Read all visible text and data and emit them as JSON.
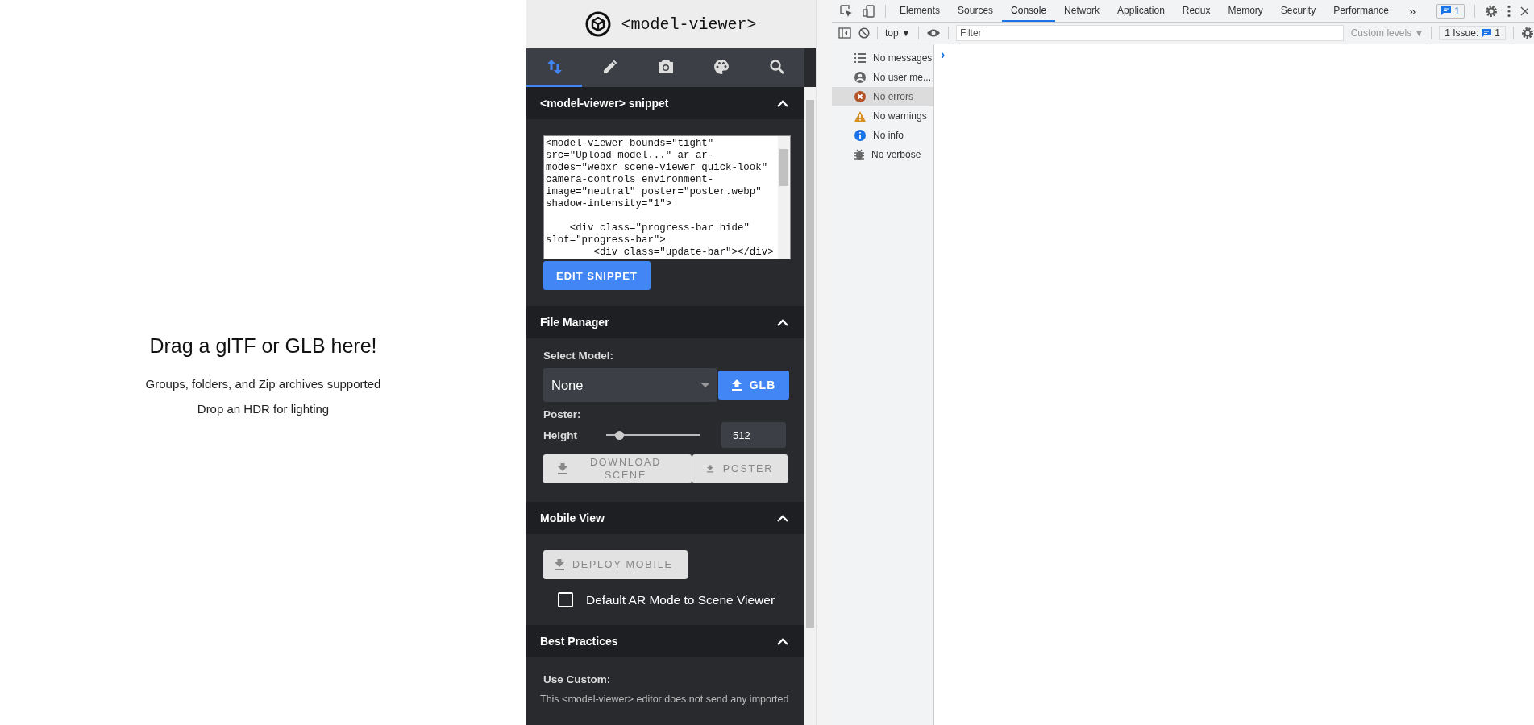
{
  "drop_zone": {
    "title": "Drag a glTF or GLB here!",
    "lines": [
      "Groups, folders, and Zip archives supported",
      "Drop an HDR for lighting"
    ]
  },
  "editor": {
    "logo_text": "<model-viewer>",
    "tabs": [
      {
        "kind": "import",
        "selected": true
      },
      {
        "kind": "edit",
        "selected": false
      },
      {
        "kind": "camera",
        "selected": false
      },
      {
        "kind": "palette",
        "selected": false
      },
      {
        "kind": "search",
        "selected": false
      }
    ],
    "snippet": {
      "header": "<model-viewer> snippet",
      "expanded": true,
      "code": "<model-viewer bounds=\"tight\"\nsrc=\"Upload model...\" ar ar-\nmodes=\"webxr scene-viewer quick-look\"\ncamera-controls environment-\nimage=\"neutral\" poster=\"poster.webp\"\nshadow-intensity=\"1\">\n\n    <div class=\"progress-bar hide\"\nslot=\"progress-bar\">\n        <div class=\"update-bar\"></div>",
      "button": "EDIT SNIPPET"
    },
    "file_manager": {
      "header": "File Manager",
      "expanded": true,
      "select_label": "Select Model:",
      "select_value": "None",
      "upload_button": "GLB",
      "poster_label": "Poster:",
      "height_label": "Height",
      "height_slider": {
        "level": 0.14
      },
      "height_value": "512",
      "download_scene": "DOWNLOAD SCENE",
      "download_poster": "POSTER"
    },
    "mobile_view": {
      "header": "Mobile View",
      "expanded": true,
      "deploy_button": "DEPLOY MOBILE",
      "checkbox": {
        "label": "Default AR Mode to Scene Viewer",
        "checked": false
      }
    },
    "best_practices": {
      "header": "Best Practices",
      "expanded": true,
      "use_custom_label": "Use Custom:",
      "note": "This <model-viewer> editor does not send any imported"
    }
  },
  "devtools": {
    "tabs": [
      {
        "label": "Elements",
        "selected": false
      },
      {
        "label": "Sources",
        "selected": false
      },
      {
        "label": "Console",
        "selected": true
      },
      {
        "label": "Network",
        "selected": false
      },
      {
        "label": "Application",
        "selected": false
      },
      {
        "label": "Redux",
        "selected": false
      },
      {
        "label": "Memory",
        "selected": false
      },
      {
        "label": "Security",
        "selected": false
      },
      {
        "label": "Performance",
        "selected": false
      }
    ],
    "more_tabs": "»",
    "issues_badge": "1",
    "context": "top ▼",
    "filter_placeholder": "Filter",
    "levels": "Custom levels ▼",
    "issues_label": "1 Issue:",
    "issues_count": "1",
    "sidebar": [
      {
        "kind": "messages",
        "label": "No messages",
        "selected": false
      },
      {
        "kind": "user",
        "label": "No user me...",
        "selected": false
      },
      {
        "kind": "errors",
        "label": "No errors",
        "selected": true
      },
      {
        "kind": "warnings",
        "label": "No warnings",
        "selected": false
      },
      {
        "kind": "info",
        "label": "No info",
        "selected": false
      },
      {
        "kind": "verbose",
        "label": "No verbose",
        "selected": false
      }
    ],
    "prompt": "›"
  }
}
